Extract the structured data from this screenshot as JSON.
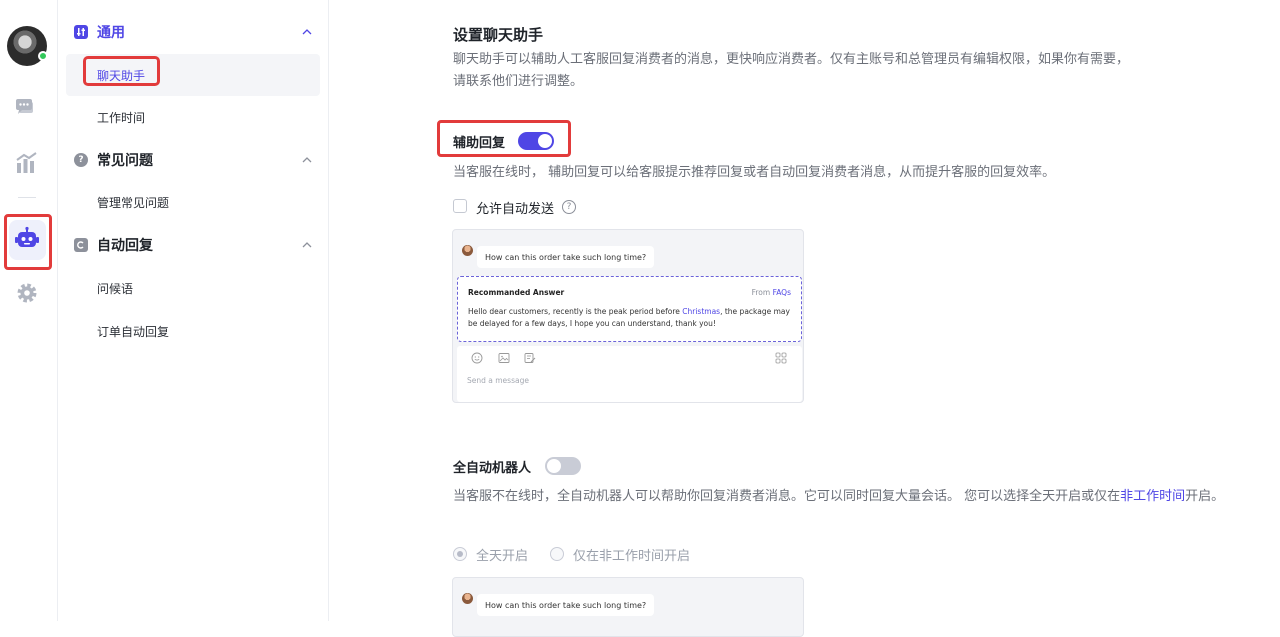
{
  "sidebar": {
    "groups": [
      {
        "label": "通用",
        "items": [
          "聊天助手",
          "工作时间"
        ]
      },
      {
        "label": "常见问题",
        "items": [
          "管理常见问题"
        ]
      },
      {
        "label": "自动回复",
        "items": [
          "问候语",
          "订单自动回复"
        ]
      }
    ]
  },
  "main": {
    "title": "设置聊天助手",
    "description_line1": "聊天助手可以辅助人工客服回复消费者的消息，更快响应消费者。仅有主账号和总管理员有编辑权限，如果你有需要，",
    "description_line2": "请联系他们进行调整。",
    "assist": {
      "label": "辅助回复",
      "enabled": true,
      "description": "当客服在线时， 辅助回复可以给客服提示推荐回复或者自动回复消费者消息，从而提升客服的回复效率。",
      "auto_send_label": "允许自动发送",
      "auto_send_checked": false
    },
    "preview": {
      "customer_message": "How can this order take such long time?",
      "answer_title": "Recommanded Answer",
      "from_prefix": "From ",
      "from_source": "FAQs",
      "answer_part1": "Hello dear customers, recently is the peak period before ",
      "answer_link": "Christmas",
      "answer_part2": ", the package may be delayed for a few days, I hope you can understand, thank you!",
      "input_placeholder": "Send a message"
    },
    "bot": {
      "label": "全自动机器人",
      "enabled": false,
      "description_part1": "当客服不在线时，全自动机器人可以帮助你回复消费者消息。它可以同时回复大量会话。 您可以选择全天开启或仅在",
      "description_link": "非工作时间",
      "description_part2": "开启。",
      "option_all_day": "全天开启",
      "option_off_hours": "仅在非工作时间开启",
      "selected_option": "全天开启"
    }
  },
  "colors": {
    "accent": "#4f46e5",
    "highlight": "#e23b3b"
  },
  "icons": [
    "avatar",
    "chat-icon",
    "stats-icon",
    "robot-icon",
    "gear-icon",
    "settings-group-icon",
    "faq-icon",
    "auto-reply-icon",
    "chevron-up-icon",
    "help-icon",
    "emoji-icon",
    "image-icon",
    "edit-icon",
    "apps-icon"
  ]
}
